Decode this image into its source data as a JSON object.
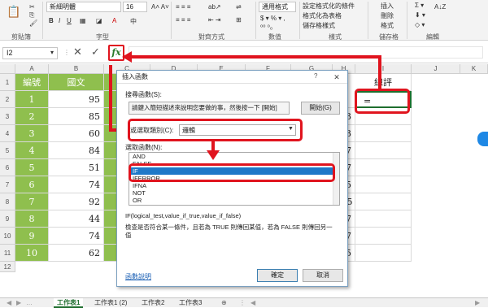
{
  "ribbon": {
    "font_name": "新細明體",
    "font_size": "16",
    "number_format": "通用格式",
    "currency": "$ ▾ % ▾ ,",
    "cond_format": "設定格式化的條件",
    "table_format": "格式化為表格",
    "cell_style": "儲存格樣式",
    "insert": "插入",
    "delete": "刪除",
    "format": "格式",
    "groups": [
      "剪貼簿",
      "字型",
      "對齊方式",
      "數值",
      "樣式",
      "儲存格",
      "編輯"
    ]
  },
  "formula_bar": {
    "name_box": "I2",
    "fx": "fx"
  },
  "columns": [
    "A",
    "B",
    "C",
    "D",
    "E",
    "F",
    "G",
    "H",
    "I",
    "J",
    "K"
  ],
  "rows": [
    "1",
    "2",
    "3",
    "4",
    "5",
    "6",
    "7",
    "8",
    "9",
    "10",
    "11",
    "12"
  ],
  "table": {
    "headers": [
      "編號",
      "國文",
      "英"
    ],
    "ids": [
      "1",
      "2",
      "3",
      "4",
      "5",
      "6",
      "7",
      "8",
      "9",
      "10"
    ],
    "chinese": [
      "95",
      "85",
      "60",
      "84",
      "51",
      "74",
      "92",
      "44",
      "74",
      "62"
    ],
    "col_h": [
      "",
      "333",
      "333",
      "667",
      "667",
      "5.5",
      "71.5",
      "667",
      "667",
      "4.5"
    ],
    "i1": "總評",
    "i2": "="
  },
  "dialog": {
    "title": "插入函數",
    "close": "✕",
    "search_label": "搜尋函數(S):",
    "search_text": "請鍵入簡短描述來說明您要做的事，然後按一下 [開始]",
    "go_button": "開始(G)",
    "category_label": "或選取類別(C):",
    "category_value": "邏輯",
    "select_label": "選取函數(N):",
    "functions": [
      "AND",
      "FALSE",
      "IF",
      "IFERROR",
      "IFNA",
      "NOT",
      "OR"
    ],
    "selected": "IF",
    "signature": "IF(logical_test,value_if_true,value_if_false)",
    "description": "檢查是否符合某一條件，且若為 TRUE 則傳回某值，若為 FALSE 則傳回另一值",
    "help_link": "函數說明",
    "ok": "確定",
    "cancel": "取消"
  },
  "sheets": [
    "工作表1",
    "工作表1 (2)",
    "工作表2",
    "工作表3"
  ],
  "colors": {
    "accent_red": "#e0141e",
    "header_green": "#8fbf4e",
    "selected_blue": "#1e78c8"
  }
}
